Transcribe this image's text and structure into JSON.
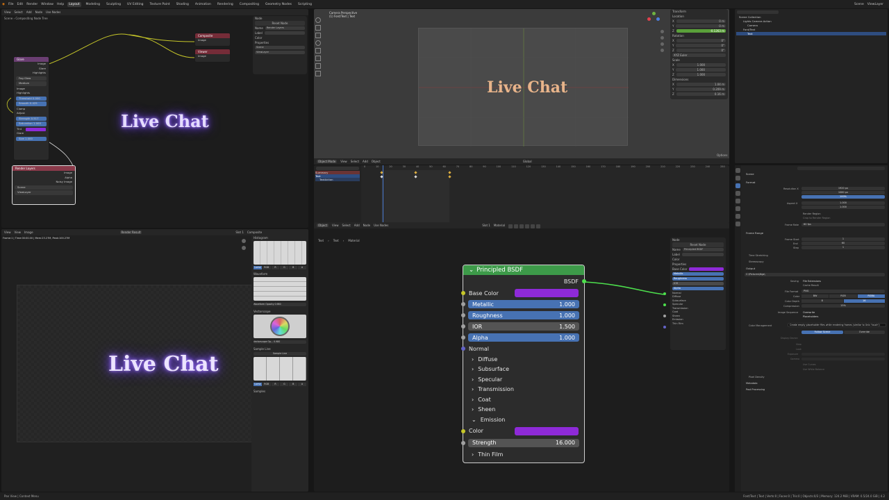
{
  "app": {
    "menus": [
      "File",
      "Edit",
      "Render",
      "Window",
      "Help"
    ],
    "workspaces": [
      "Layout",
      "Modeling",
      "Sculpting",
      "UV Editing",
      "Texture Paint",
      "Shading",
      "Animation",
      "Rendering",
      "Compositing",
      "Geometry Nodes",
      "Scripting"
    ],
    "active_workspace": "Layout",
    "scene": "Scene",
    "view_layer": "ViewLayer"
  },
  "compositor": {
    "header": [
      "View",
      "Select",
      "Add",
      "Node",
      "Use Nodes"
    ],
    "breadcrumb": "Compositing Node Tree",
    "scene_label": "Scene",
    "preview_text": "Live Chat",
    "panel": {
      "title": "Node",
      "reset": "Reset Node",
      "name_label": "Name",
      "name_value": "Render Layers",
      "label_label": "Label",
      "color": "Color",
      "properties": "Properties",
      "scene": "Scene",
      "layer": "ViewLayer"
    },
    "nodes": {
      "glare": {
        "title": "Glare",
        "outputs": [
          "Image",
          "Glare",
          "Highlights"
        ],
        "type": "Fog Glow",
        "quality": "Medium",
        "rows": [
          "Image",
          "Highlights",
          "Threshold 0.000",
          "Smooth 0.425",
          "Clamp",
          "Adjust",
          "Strength 0.517",
          "Saturation 1.000",
          "Tint",
          "Glare",
          "Size 1.000"
        ]
      },
      "composite": {
        "title": "Composite",
        "input": "Image"
      },
      "viewer": {
        "title": "Viewer",
        "input": "Image"
      },
      "render_layers": {
        "title": "Render Layers",
        "outputs": [
          "Image",
          "Alpha",
          "Noisy Image"
        ],
        "scene": "Scene",
        "layer": "ViewLayer"
      }
    }
  },
  "viewport": {
    "title": "Camera Perspective",
    "subtitle": "(1) Font/Text | Text",
    "text": "Live Chat",
    "header": [
      "Object Mode",
      "View",
      "Select",
      "Add",
      "Object",
      "Global"
    ],
    "transform": {
      "title": "Transform",
      "location": "Location",
      "rotation": "Rotation",
      "mode": "XYZ Euler",
      "scale": "Scale",
      "dimensions": "Dimensions",
      "loc": [
        "0 m",
        "0 m",
        "-0.1263 m"
      ],
      "rot": [
        "0°",
        "0°",
        "0°"
      ],
      "scl": [
        "1.000",
        "1.000",
        "1.000"
      ],
      "dim": [
        "1.04 m",
        "0.209 m",
        "0.16 m"
      ]
    },
    "options": "Options"
  },
  "outliner": {
    "items": [
      "Scene Collection",
      "Lights Camera Action",
      "Camera",
      "Font/Text",
      "Text"
    ]
  },
  "dopesheet": {
    "rows": [
      "Summary",
      "Text",
      "TextAction"
    ],
    "frames": [
      "0",
      "10",
      "20",
      "30",
      "40",
      "50",
      "60",
      "70",
      "80",
      "90",
      "100",
      "110",
      "120",
      "130",
      "140",
      "150",
      "160",
      "170",
      "180",
      "190",
      "200",
      "210",
      "220",
      "230",
      "240",
      "250"
    ]
  },
  "image_editor": {
    "header": [
      "View",
      "View",
      "Image"
    ],
    "image_name": "Render Result",
    "slot": "Slot 1",
    "layer": "Composite",
    "info": "Frame:1 | Time:00:00.00 | Mem:23.27M, Peak:100.27M",
    "preview_text": "Live Chat",
    "scopes": [
      "Histogram",
      "Waveform",
      "Vectorscope",
      "Sample Line",
      "Samples"
    ],
    "hist_modes": [
      "Luma",
      "RGB",
      "R",
      "G",
      "B",
      "A"
    ],
    "waveform_opacity": "Waveform Opacity 0.980",
    "vectorscope_opacity": "Vectorscope Op... 0.980",
    "sample_line": "Sample Line"
  },
  "shader": {
    "header": [
      "Object",
      "View",
      "Select",
      "Add",
      "Node",
      "Use Nodes"
    ],
    "breadcrumb": [
      "Text",
      "Text",
      "Material"
    ],
    "slot": "Slot 1",
    "material": "Material",
    "node": {
      "title": "Principled BSDF",
      "output": "BSDF",
      "base_color": "Base Color",
      "sliders": [
        {
          "label": "Metallic",
          "value": "1.000"
        },
        {
          "label": "Roughness",
          "value": "1.000"
        },
        {
          "label": "IOR",
          "value": "1.500"
        },
        {
          "label": "Alpha",
          "value": "1.000"
        }
      ],
      "normal": "Normal",
      "panels": [
        "Diffuse",
        "Subsurface",
        "Specular",
        "Transmission",
        "Coat",
        "Sheen"
      ],
      "emission": "Emission",
      "emission_color": "Color",
      "strength_label": "Strength",
      "strength_value": "16.000",
      "thin_film": "Thin Film"
    },
    "panel": {
      "title": "Node",
      "reset": "Reset Node",
      "name_label": "Name",
      "name_value": "Principled BSDF",
      "label_label": "Label",
      "color": "Color",
      "properties": "Properties",
      "base_color": "Base Color",
      "rows": [
        "Metallic",
        "Roughness",
        "IOR",
        "Alpha",
        "Normal",
        "Diffuse",
        "Subsurface",
        "Specular",
        "Transmission",
        "Coat",
        "Sheen",
        "Emission",
        "Thin Film"
      ]
    }
  },
  "properties": {
    "scene": "Scene",
    "format": "Format",
    "resolution_x": "Resolution X",
    "res_x_val": "1920 px",
    "res_y_val": "1080 px",
    "res_pct": "100%",
    "aspect_x": "Aspect X",
    "aspect_vals": [
      "1.000",
      "1.000"
    ],
    "render_region": "Render Region",
    "crop": "Crop to Render Region",
    "frame_rate": "Frame Rate",
    "fps": "60 fps",
    "frame_range": "Frame Range",
    "frame_start": "Frame Start",
    "frame_vals": [
      "1",
      "60",
      "1"
    ],
    "end": "End",
    "step": "Step",
    "time_stretching": "Time Stretching",
    "stereoscopy": "Stereoscopy",
    "output": "Output",
    "path": "C:\\Pictures\\Ngs\\",
    "saving": "Saving",
    "file_extensions": "File Extensions",
    "cache_result": "Cache Result",
    "file_format": "File Format",
    "png": "PNG",
    "color": "Color",
    "color_modes": [
      "BW",
      "RGB",
      "RGBA"
    ],
    "color_depth": "Color Depth",
    "depths": [
      "8",
      "16"
    ],
    "compression": "Compression",
    "compression_val": "15%",
    "image_sequence": "Image Sequence",
    "overwrite": "Overwrite",
    "placeholders": "Placeholders",
    "tooltip": "Create empty placeholder files while rendering frames (similar to Unix 'touch')",
    "color_management": "Color Management",
    "follow_scene": "Follow Scene",
    "override": "Override",
    "display_device": "Display Device",
    "view": "View",
    "look": "Look",
    "exposure": "Exposure",
    "gamma": "Gamma",
    "use_curves": "Use Curves",
    "white_balance": "Use White Balance",
    "pixel_density": "Pixel Density",
    "metadata": "Metadata",
    "post_processing": "Post Processing"
  },
  "status": {
    "left": "Pan View  |  Context Menu",
    "right": "Font/Text | Text | Verts:0 | Faces:0 | Tris:0 | Objects:0/3 | Memory: 124.2 MiB | VRAM: 0.5/24.0 GiB | 4.2"
  },
  "colors": {
    "accent": "#4772b3",
    "base_color": "#8e2ad8",
    "glow": "#b695ff",
    "text_orange": "#e8b48a",
    "bsdf_header": "#3d9a49"
  }
}
